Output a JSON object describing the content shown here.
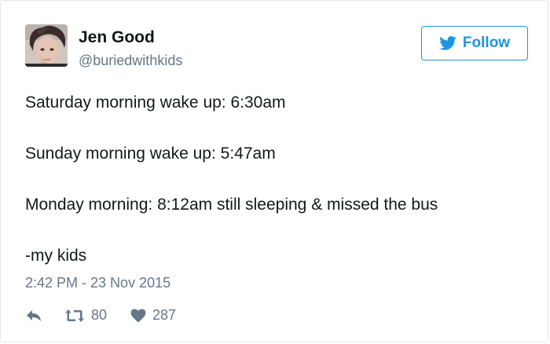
{
  "author": {
    "name": "Jen Good",
    "handle": "@buriedwithkids"
  },
  "follow_button": {
    "label": "Follow",
    "icon": "twitter-bird-icon"
  },
  "tweet": {
    "lines": [
      "Saturday morning wake up: 6:30am",
      "Sunday morning wake up: 5:47am",
      "Monday morning: 8:12am still sleeping & missed the bus",
      "-my kids"
    ],
    "timestamp": "2:42 PM - 23 Nov 2015"
  },
  "actions": {
    "reply_icon": "reply-icon",
    "retweet_icon": "retweet-icon",
    "retweet_count": "80",
    "like_icon": "heart-icon",
    "like_count": "287"
  },
  "colors": {
    "accent": "#1b95e0",
    "secondary_text": "#657786",
    "border": "#e1e8ed"
  }
}
